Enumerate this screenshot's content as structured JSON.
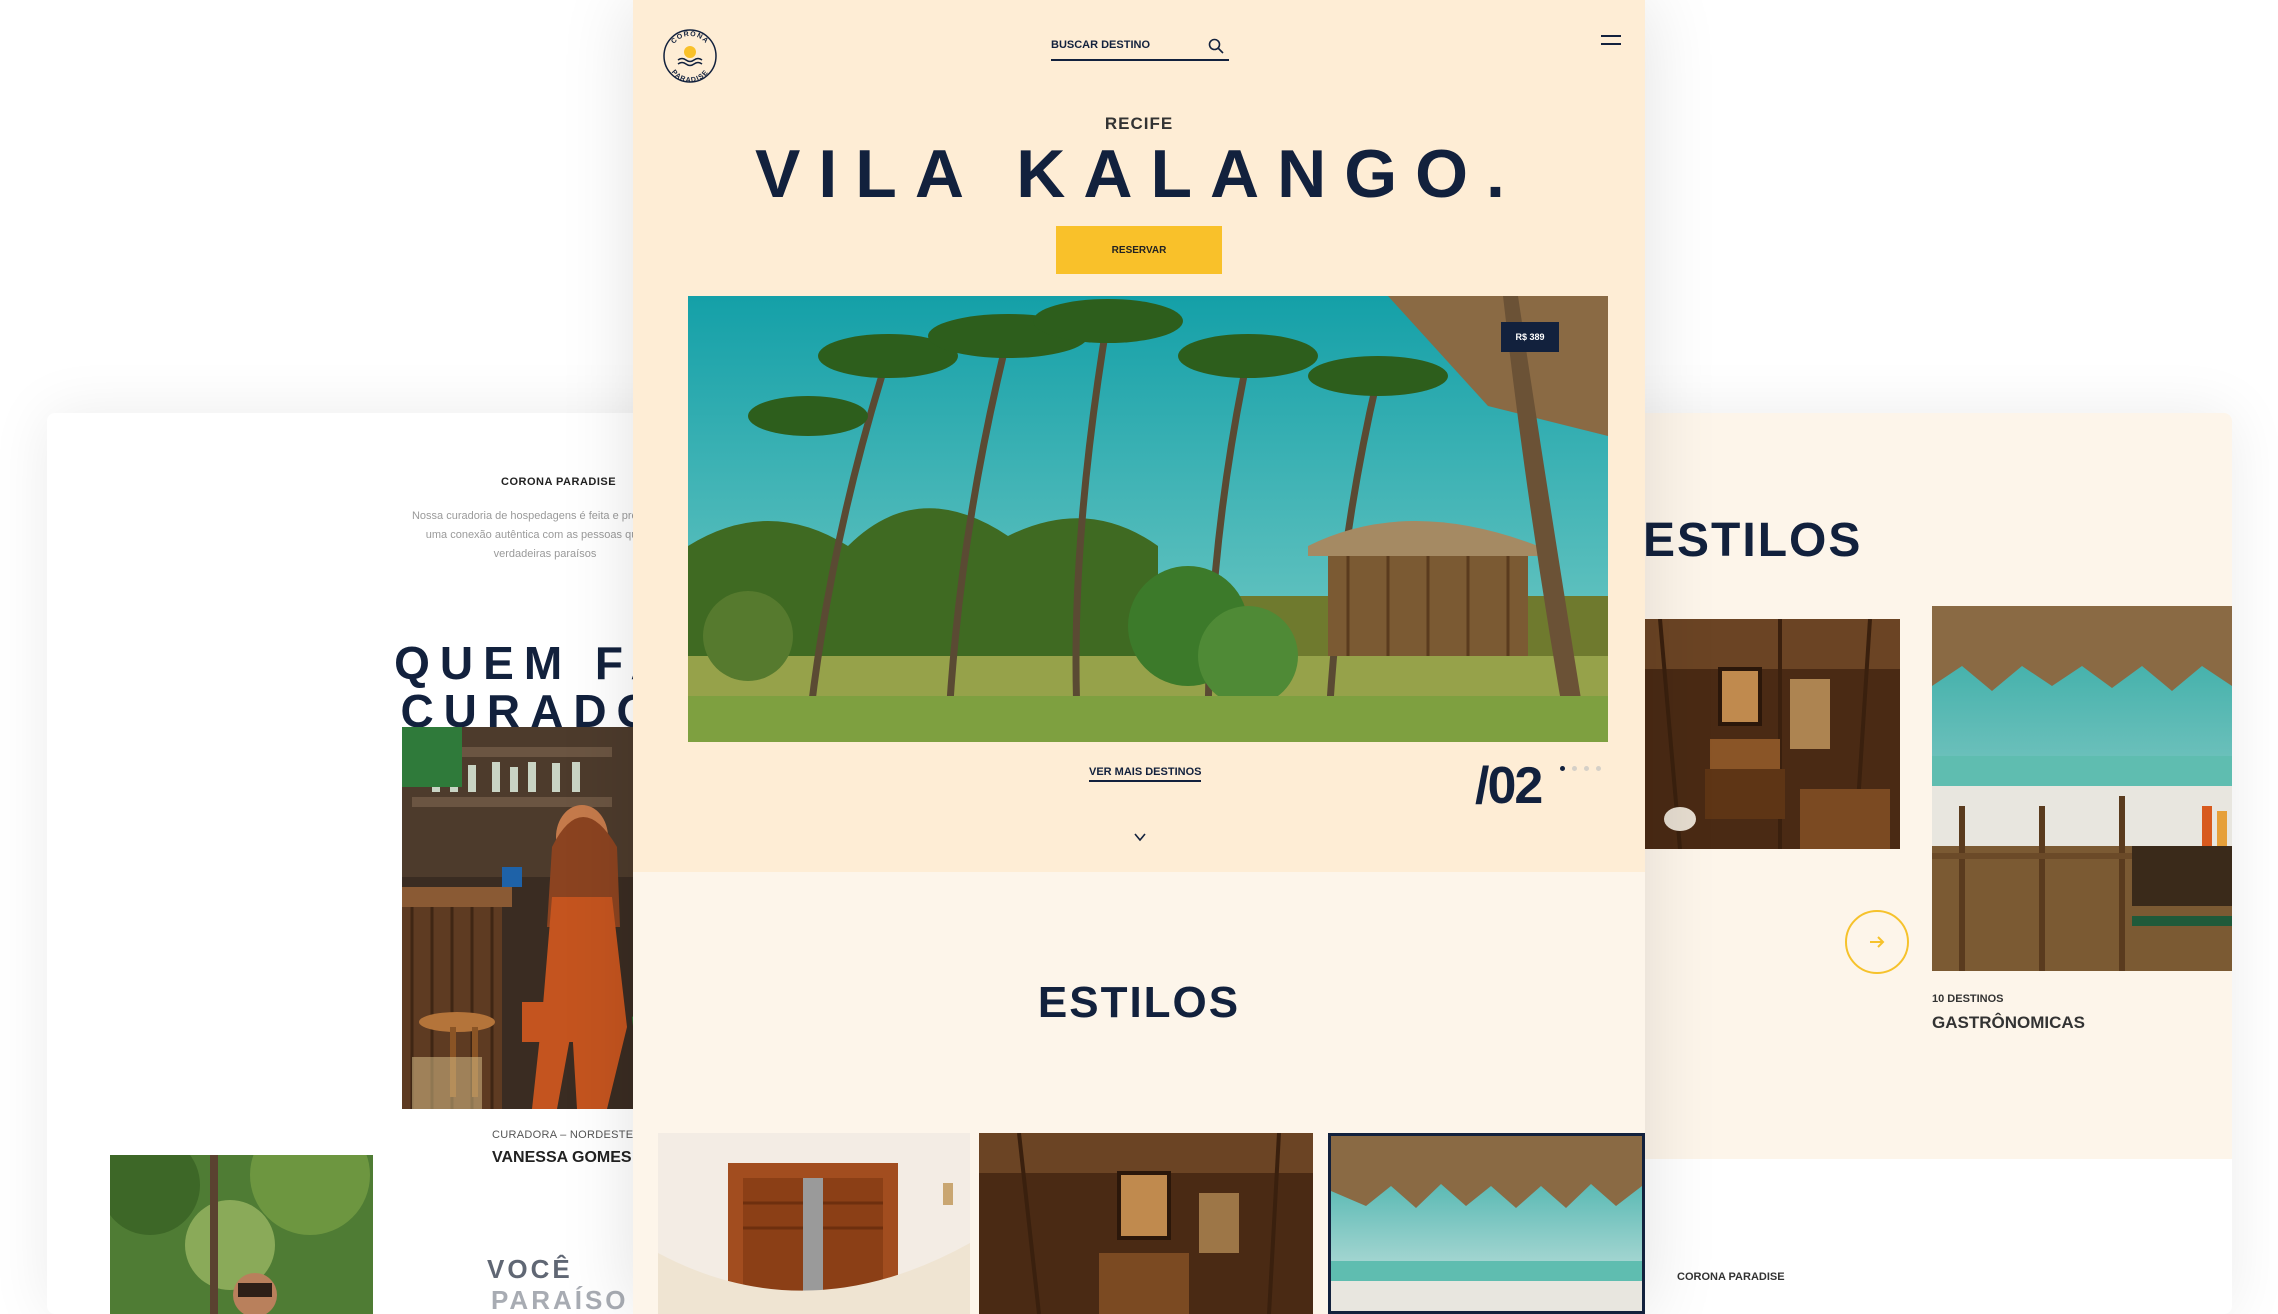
{
  "left": {
    "brand": "CORONA PARADISE",
    "intro": "Nossa curadoria de hospedagens é feita e procura por uma conexão autêntica com as pessoas que são verdadeiras paraísos",
    "heading_line1": "QUEM FAZ",
    "heading_line2": "CURADOR",
    "curator_role": "CURADORA – NORDESTE",
    "curator_name": "VANESSA GOMES",
    "next_line1": "VOCÊ",
    "next_line2": "PARAÍSO"
  },
  "header": {
    "logo_top": "CORONA",
    "logo_bottom": "PARADISE",
    "search_placeholder": "BUSCAR DESTINO",
    "search_icon": "search-icon",
    "menu_icon": "menu-icon"
  },
  "hero": {
    "city": "RECIFE",
    "title": "VILA KALANGO.",
    "reserve_label": "RESERVAR",
    "price_badge": "R$ 389",
    "more_link": "VER MAIS DESTINOS",
    "counter": "/02",
    "slides_total": 4,
    "slide_active": 1
  },
  "styles_section": {
    "title": "ESTILOS"
  },
  "right": {
    "title": "ESTILOS",
    "count": "10 DESTINOS",
    "category": "GASTRÔNOMICAS",
    "brand": "CORONA PARADISE"
  },
  "colors": {
    "navy": "#12213d",
    "yellow": "#f9c12a",
    "cream": "#feedd5"
  }
}
